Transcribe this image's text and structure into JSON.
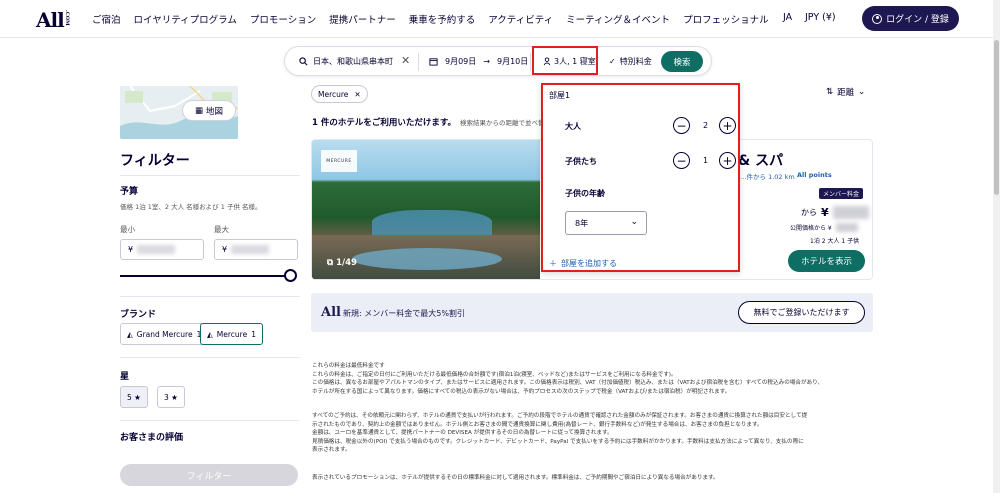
{
  "header": {
    "nav": [
      "ご宿泊",
      "ロイヤリティプログラム",
      "プロモーション",
      "提携パートナー",
      "乗車を予約する",
      "アクティビティ",
      "ミーティング＆イベント",
      "プロフェッショナル"
    ],
    "lang": "JA",
    "currency": "JPY (¥)",
    "login": "ログイン / 登録"
  },
  "search": {
    "destination": "日本、和歌山県串本町",
    "check_in": "9月09日",
    "check_out": "9月10日",
    "guests": "3人, 1 寝室",
    "rate": "特別料金",
    "search_btn": "検索"
  },
  "sidebar": {
    "map_btn": "地図",
    "filter_title": "フィルター",
    "budget_title": "予算",
    "budget_desc": "価格 1泊 1室、2 大人 名様および 1 子供 名様。",
    "min_label": "最小",
    "max_label": "最大",
    "currency_symbol": "¥",
    "brand_title": "ブランド",
    "brands": [
      {
        "name": "Grand Mercure",
        "count": "1"
      },
      {
        "name": "Mercure",
        "count": "1"
      }
    ],
    "stars_title": "星",
    "stars": [
      "5 ★",
      "3 ★"
    ],
    "rating_title": "お客さまの評価",
    "filter_btn": "フィルター"
  },
  "main": {
    "tag": "Mercure",
    "result_count": "1 件のホテルをご利用いただけます。",
    "result_note": "検索結果からの距離で並べ替え",
    "sort_label": "距離",
    "hotel": {
      "name": "& スパ",
      "distance": "…件から 1.02 km",
      "points": "All points",
      "member_badge": "メンバー料金",
      "from": "から",
      "yen": "¥",
      "public_price": "公開価格から ¥",
      "nights": "1泊 2 大人 1 子供",
      "photo_count": "1/49",
      "view_btn": "ホテルを表示"
    },
    "promo": {
      "text": "新規: メンバー料金で最大5%割引",
      "btn": "無料でご登録いただけます"
    },
    "disclaimer1": [
      "これらの料金は最低料金です",
      "これらの料金は、ご指定の日付にご利用いただける最低価格の合計額です(宿泊1泊(寝室、ベッドなど)またはサービスをご利用になる料金です)。",
      "この価格は、異なるお部屋やアパルトマンのタイプ、またはサービスに適用されます。この価格表示は税別、VAT（付加価値税）税込み、または（VATおよび宿泊税を含む）すべての税込みの場合があり、",
      "ホテルが所在する国によって異なります。価格にすべての税込の表示がない場合は、予約プロセスの次のステップで税金（VATおよび/または宿泊税）が明記されます。"
    ],
    "disclaimer2": [
      "すべてのご予約は、その依頼元に関わらず、ホテルの通貨で支払いが行われます。ご予約の段階でホテルの通貨で確認された金額のみが保証されます。お客さまの通貨に換算された額は目安として提",
      "示されたものであり、契約上の金額ではありません。ホテル側とお客さまの間で通貨換算に関し費用(為替レート、銀行手数料など)が発生する場合は、お客さまの負担となります。",
      "金額は、ユーロを基準通貨として、提携パートナーの DEVISEA が提供するその日の為替レートに従って換算されます。",
      "見積価格は、税金以外の(POI) で支払う場合のものです。クレジットカード、デビットカード、PayPal で支払いをする予約には手数料がかかります。手数料は支払方法によって異なり、支払の際に",
      "表示されます。"
    ],
    "disclaimer3": [
      "表示されているプロモーションは、ホテルが提供するその日の標準料金に対して適用されます。標準料金は、ご予約期間やご宿泊日により異なる場合があります。"
    ]
  },
  "popup": {
    "room_label": "部屋1",
    "adults_label": "大人",
    "adults": "2",
    "children_label": "子供たち",
    "children": "1",
    "child_age_label": "子供の年齢",
    "child_age": "8年",
    "add_room": "部屋を追加する"
  },
  "colors": {
    "navy": "#1e1852",
    "teal": "#0f6e64",
    "highlight": "#e02020"
  }
}
